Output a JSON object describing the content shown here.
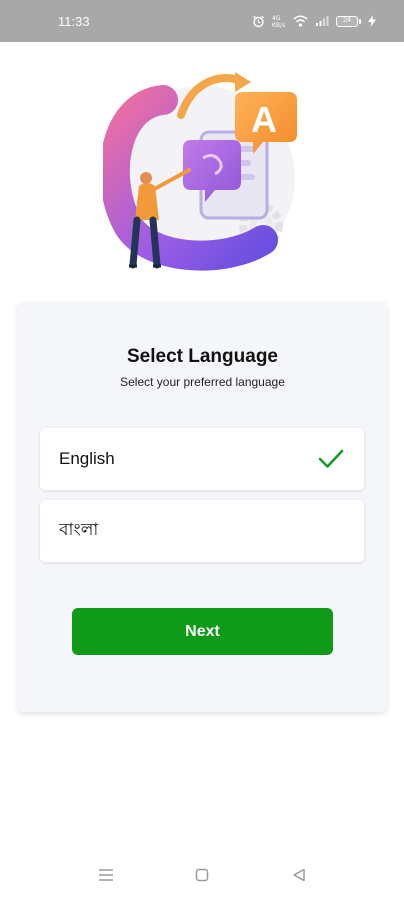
{
  "status_bar": {
    "time": "11:33",
    "battery_level": "24",
    "icons": [
      "alarm-icon",
      "data-icon",
      "wifi-icon",
      "signal-icon",
      "battery-icon",
      "charging-icon"
    ]
  },
  "illustration": {
    "letter": "A",
    "colors": {
      "orange": "#f29a3a",
      "purple": "#9b5de5",
      "pink": "#d66fc7",
      "gear": "#e5e5e8"
    }
  },
  "card": {
    "title": "Select Language",
    "subtitle": "Select your preferred language",
    "options": [
      {
        "label": "English",
        "selected": true
      },
      {
        "label": "বাংলা",
        "selected": false
      }
    ],
    "next_label": "Next"
  },
  "colors": {
    "accent": "#0f9a1a",
    "check": "#1a9a2a",
    "status_bar_bg": "#a8a8a8",
    "card_bg": "#f4f6f9"
  },
  "nav_bar": {
    "icons": [
      "menu-icon",
      "home-square-icon",
      "back-triangle-icon"
    ]
  }
}
